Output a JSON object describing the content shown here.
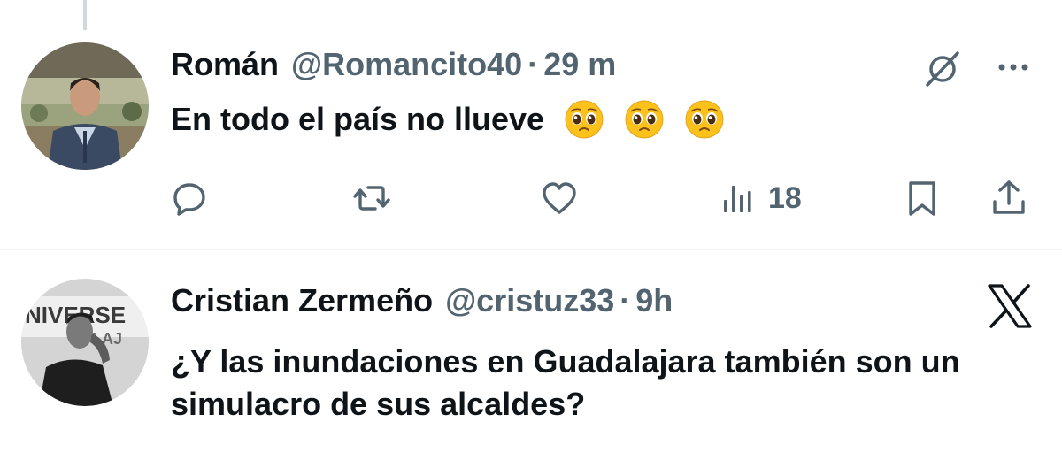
{
  "tweets": [
    {
      "author": {
        "name": "Román",
        "handle": "@Romancito40"
      },
      "separator": "·",
      "time": "29 m",
      "text": "En todo el país no llueve",
      "emojis": [
        "pleading-face",
        "pleading-face",
        "pleading-face"
      ],
      "actions": {
        "reply": "reply-icon",
        "retweet": "retweet-icon",
        "like": "heart-icon",
        "views": {
          "icon": "views-icon",
          "count": "18"
        },
        "bookmark": "bookmark-icon",
        "share": "share-icon"
      }
    },
    {
      "author": {
        "name": "Cristian Zermeño",
        "handle": "@cristuz33"
      },
      "separator": "·",
      "time": "9h",
      "text": "¿Y las inundaciones en Guadalajara también son un simulacro de sus alcaldes?",
      "source_logo": "x-logo-icon"
    }
  ],
  "colors": {
    "primary_text": "#0f1419",
    "secondary_text": "#536471",
    "divider": "#eff3f4",
    "thread_line": "#cfd9de"
  }
}
